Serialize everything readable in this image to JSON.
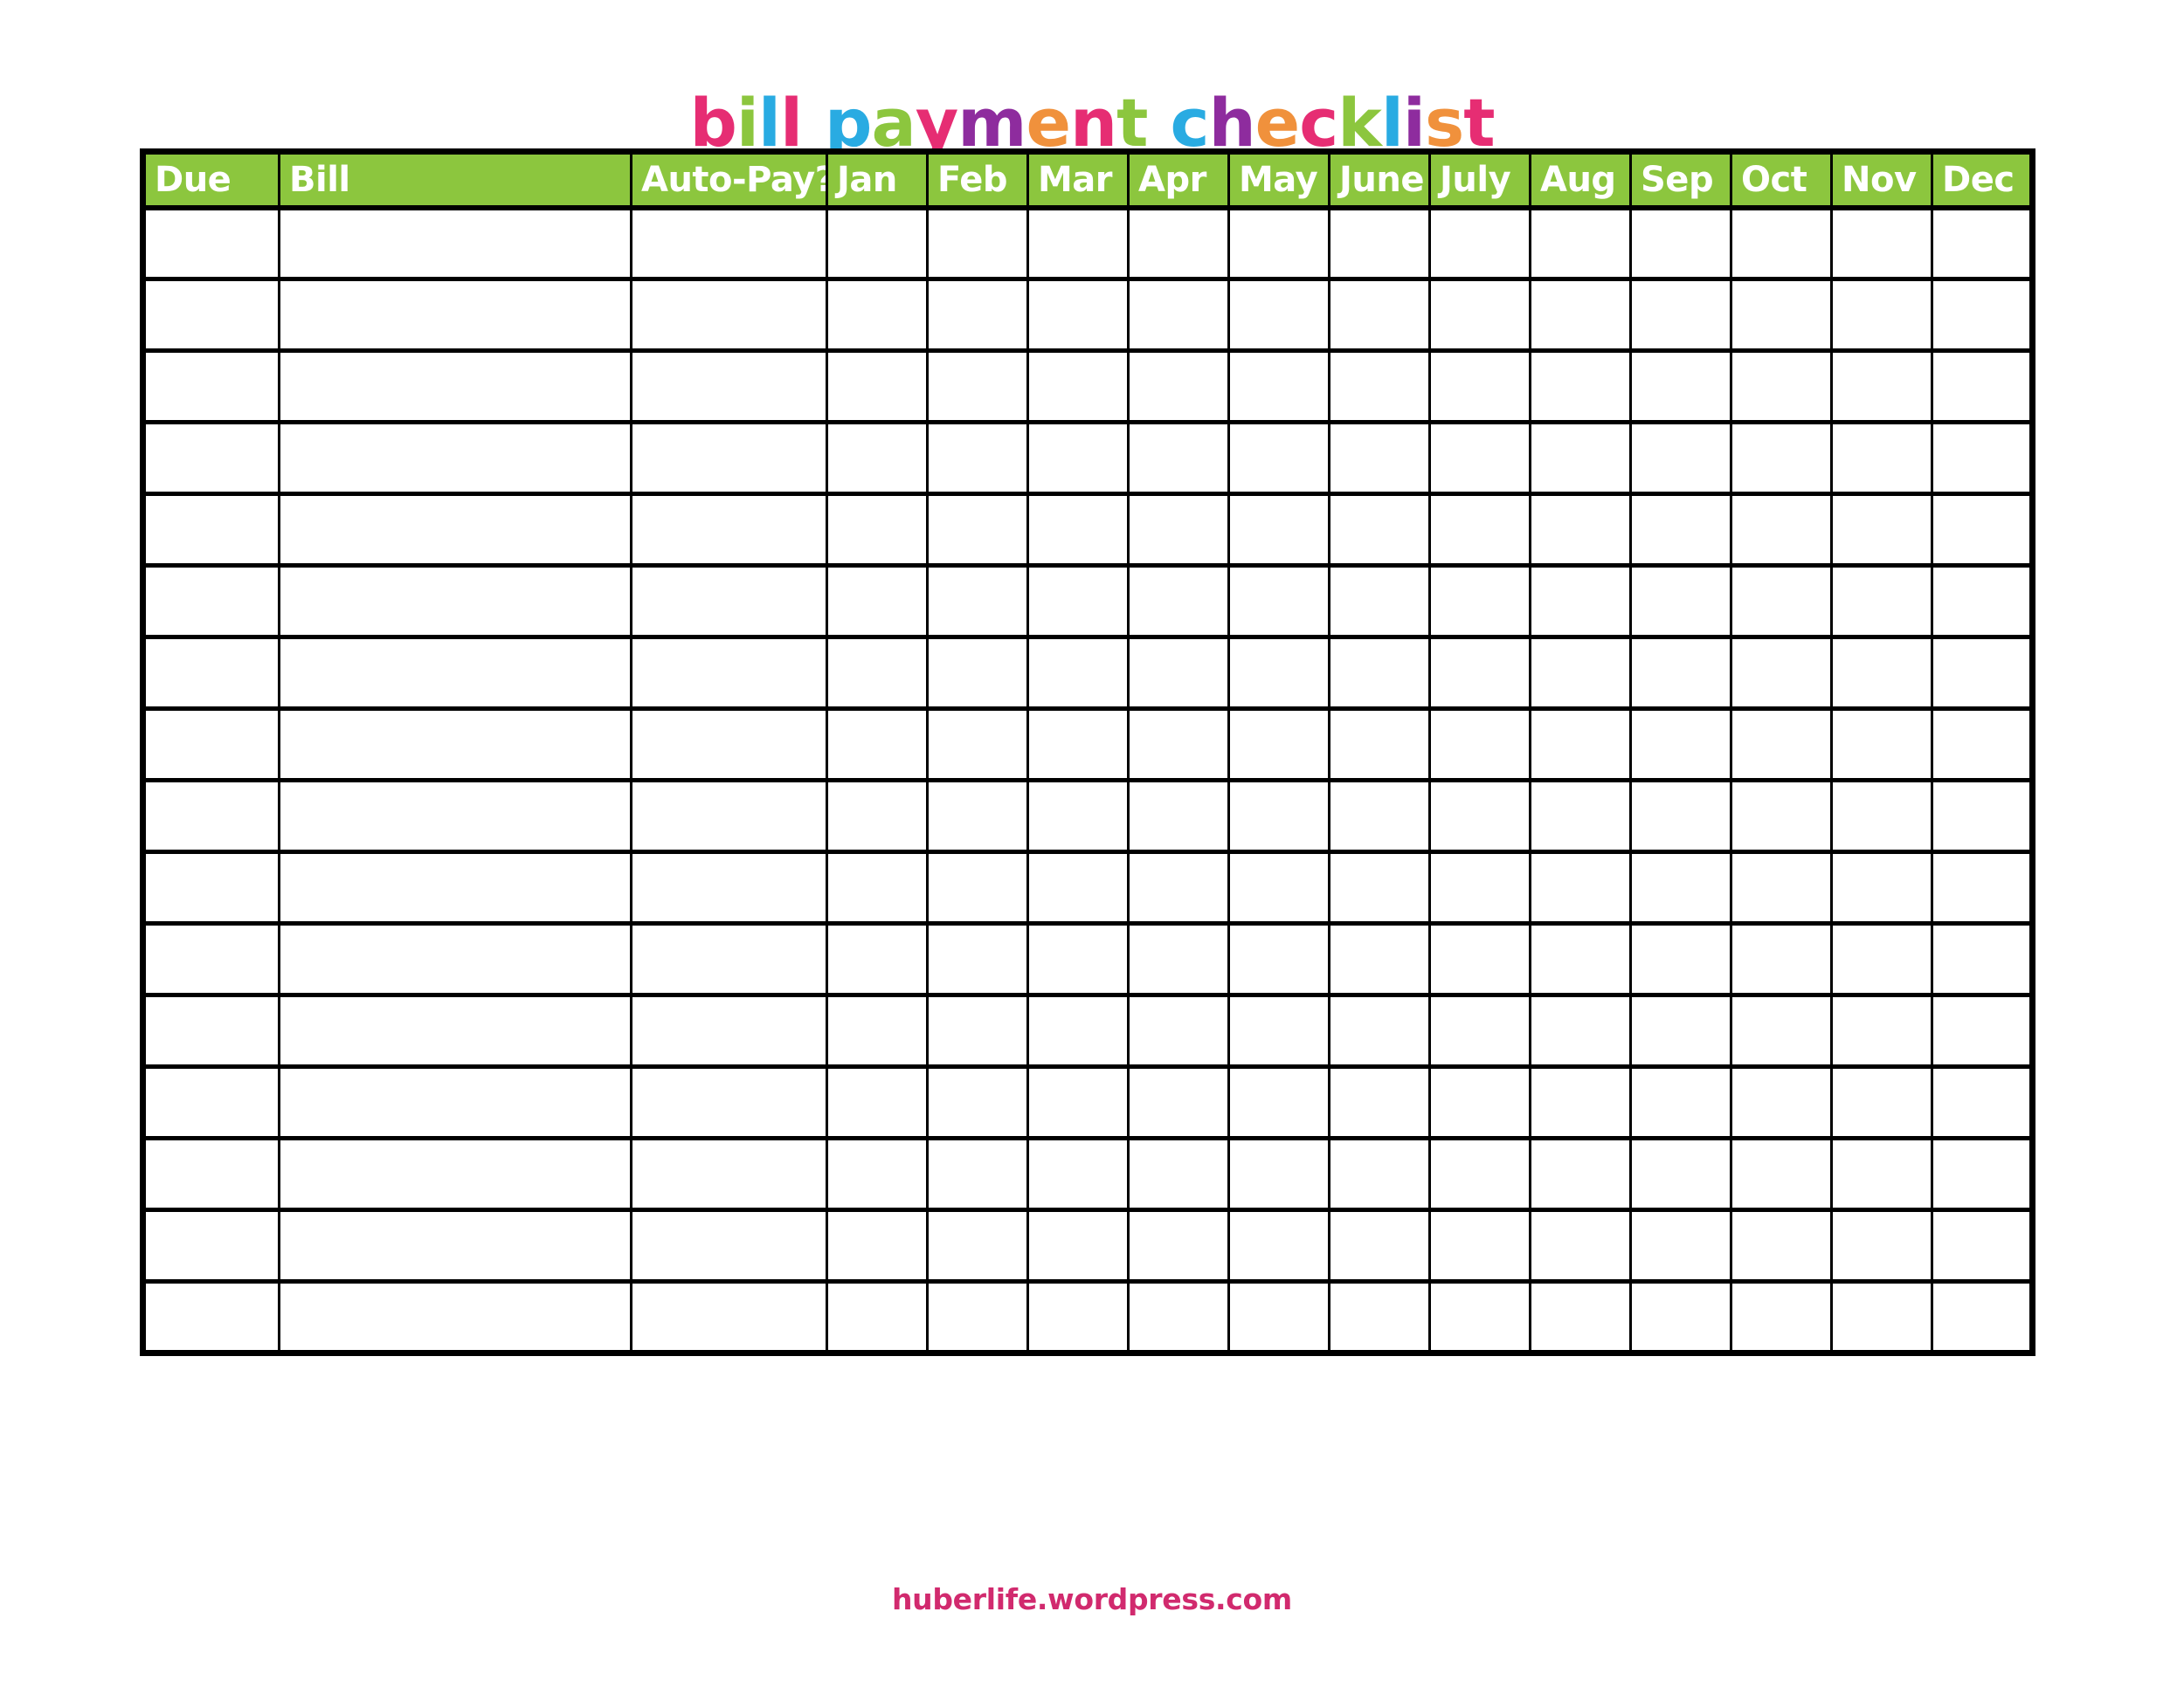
{
  "document": {
    "title": "bill payment checklist",
    "background_color": "#ffffff"
  },
  "title": {
    "text": "bill payment checklist",
    "letters": [
      {
        "ch": "b",
        "color": "#E62D73"
      },
      {
        "ch": "i",
        "color": "#8CC63E"
      },
      {
        "ch": "l",
        "color": "#29ABE2"
      },
      {
        "ch": "l",
        "color": "#E62D73"
      },
      {
        "ch": " ",
        "color": ""
      },
      {
        "ch": "p",
        "color": "#29ABE2"
      },
      {
        "ch": "a",
        "color": "#8CC63E"
      },
      {
        "ch": "y",
        "color": "#E62D73"
      },
      {
        "ch": "m",
        "color": "#8E2C9E"
      },
      {
        "ch": "e",
        "color": "#F0913C"
      },
      {
        "ch": "n",
        "color": "#E62D73"
      },
      {
        "ch": "t",
        "color": "#8CC63E"
      },
      {
        "ch": " ",
        "color": ""
      },
      {
        "ch": "c",
        "color": "#29ABE2"
      },
      {
        "ch": "h",
        "color": "#8E2C9E"
      },
      {
        "ch": "e",
        "color": "#F0913C"
      },
      {
        "ch": "c",
        "color": "#E62D73"
      },
      {
        "ch": "k",
        "color": "#8CC63E"
      },
      {
        "ch": "l",
        "color": "#29ABE2"
      },
      {
        "ch": "i",
        "color": "#8E2C9E"
      },
      {
        "ch": "s",
        "color": "#F0913C"
      },
      {
        "ch": "t",
        "color": "#E62D73"
      }
    ]
  },
  "table": {
    "header_background": "#8CC63E",
    "header_text_color": "#ffffff",
    "border_color": "#000000",
    "columns": [
      {
        "key": "due",
        "label": "Due",
        "width_class": "c-due"
      },
      {
        "key": "bill",
        "label": "Bill",
        "width_class": "c-bill"
      },
      {
        "key": "autopay",
        "label": "Auto-Pay?",
        "width_class": "c-autopay"
      },
      {
        "key": "jan",
        "label": "Jan",
        "width_class": "c-month"
      },
      {
        "key": "feb",
        "label": "Feb",
        "width_class": "c-month"
      },
      {
        "key": "mar",
        "label": "Mar",
        "width_class": "c-month"
      },
      {
        "key": "apr",
        "label": "Apr",
        "width_class": "c-month"
      },
      {
        "key": "may",
        "label": "May",
        "width_class": "c-month"
      },
      {
        "key": "june",
        "label": "June",
        "width_class": "c-month"
      },
      {
        "key": "july",
        "label": "July",
        "width_class": "c-month"
      },
      {
        "key": "aug",
        "label": "Aug",
        "width_class": "c-month"
      },
      {
        "key": "sep",
        "label": "Sep",
        "width_class": "c-month"
      },
      {
        "key": "oct",
        "label": "Oct",
        "width_class": "c-month"
      },
      {
        "key": "nov",
        "label": "Nov",
        "width_class": "c-month"
      },
      {
        "key": "dec",
        "label": "Dec",
        "width_class": "c-month"
      }
    ],
    "row_count": 16,
    "rows": [
      [
        "",
        "",
        "",
        "",
        "",
        "",
        "",
        "",
        "",
        "",
        "",
        "",
        "",
        "",
        ""
      ],
      [
        "",
        "",
        "",
        "",
        "",
        "",
        "",
        "",
        "",
        "",
        "",
        "",
        "",
        "",
        ""
      ],
      [
        "",
        "",
        "",
        "",
        "",
        "",
        "",
        "",
        "",
        "",
        "",
        "",
        "",
        "",
        ""
      ],
      [
        "",
        "",
        "",
        "",
        "",
        "",
        "",
        "",
        "",
        "",
        "",
        "",
        "",
        "",
        ""
      ],
      [
        "",
        "",
        "",
        "",
        "",
        "",
        "",
        "",
        "",
        "",
        "",
        "",
        "",
        "",
        ""
      ],
      [
        "",
        "",
        "",
        "",
        "",
        "",
        "",
        "",
        "",
        "",
        "",
        "",
        "",
        "",
        ""
      ],
      [
        "",
        "",
        "",
        "",
        "",
        "",
        "",
        "",
        "",
        "",
        "",
        "",
        "",
        "",
        ""
      ],
      [
        "",
        "",
        "",
        "",
        "",
        "",
        "",
        "",
        "",
        "",
        "",
        "",
        "",
        "",
        ""
      ],
      [
        "",
        "",
        "",
        "",
        "",
        "",
        "",
        "",
        "",
        "",
        "",
        "",
        "",
        "",
        ""
      ],
      [
        "",
        "",
        "",
        "",
        "",
        "",
        "",
        "",
        "",
        "",
        "",
        "",
        "",
        "",
        ""
      ],
      [
        "",
        "",
        "",
        "",
        "",
        "",
        "",
        "",
        "",
        "",
        "",
        "",
        "",
        "",
        ""
      ],
      [
        "",
        "",
        "",
        "",
        "",
        "",
        "",
        "",
        "",
        "",
        "",
        "",
        "",
        "",
        ""
      ],
      [
        "",
        "",
        "",
        "",
        "",
        "",
        "",
        "",
        "",
        "",
        "",
        "",
        "",
        "",
        ""
      ],
      [
        "",
        "",
        "",
        "",
        "",
        "",
        "",
        "",
        "",
        "",
        "",
        "",
        "",
        "",
        ""
      ],
      [
        "",
        "",
        "",
        "",
        "",
        "",
        "",
        "",
        "",
        "",
        "",
        "",
        "",
        "",
        ""
      ],
      [
        "",
        "",
        "",
        "",
        "",
        "",
        "",
        "",
        "",
        "",
        "",
        "",
        "",
        "",
        ""
      ]
    ]
  },
  "footer": {
    "text": "huberlife.wordpress.com",
    "color": "#D12A6E"
  }
}
